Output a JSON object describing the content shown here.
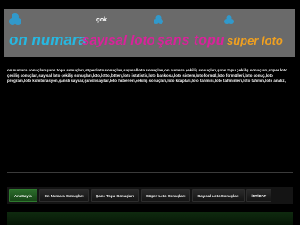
{
  "banner": {
    "words": [
      "on numara",
      "sayısal loto",
      "şans topu",
      "süper loto"
    ],
    "badge": "çok",
    "colors": {
      "background": "#6a6a6a",
      "cyan": "#27b7e0",
      "magenta": "#d8239a",
      "blue": "#1e78c8"
    }
  },
  "keywords": {
    "text": "on numara sonuçları,şans topu sonuçları,süper loto sonuçları,sayısal loto sonuçları,on numara çekiliş sonuçları,şans topu çekiliş sonuçları,süper loto çekiliş sonuçları,sayısal loto çekiliş sonuçları,loto,lotto,lottery,loto istatistik,loto bankosu,loto sistem,loto formül,loto formülleri,loto sonuç,loto program,loto kombinasyon,şanslı sayılar,şanslı sayılar,loto haberleri,çekiliş sonuçları,loto kitapları,loto tahmini,loto tahminleri,loto tahmin,loto analiz,"
  },
  "nav": {
    "items": [
      {
        "label": "AnaSayfa",
        "active": true
      },
      {
        "label": "On Numara Sonuçları",
        "active": false
      },
      {
        "label": "Şans Topu Sonuçları",
        "active": false
      },
      {
        "label": "Süper Loto Sonuçları",
        "active": false
      },
      {
        "label": "Sayısal Loto Sonuçları",
        "active": false
      },
      {
        "label": "İRTİBAT",
        "active": false
      }
    ]
  }
}
